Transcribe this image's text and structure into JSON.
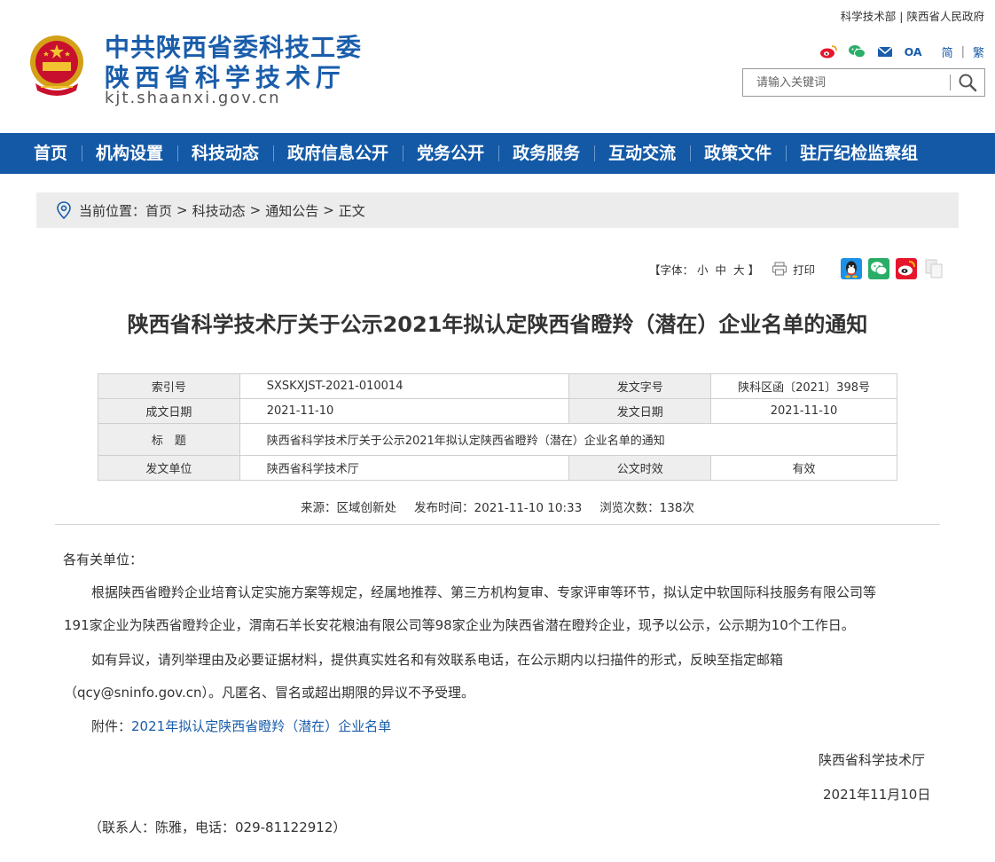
{
  "header": {
    "org_name_1": "中共陕西省委科技工委",
    "org_name_2": "陕西省科学技术厅",
    "domain": "kjt.shaanxi.gov.cn",
    "top_links": [
      "科学技术部",
      "陕西省人民政府"
    ],
    "oa_label": "OA",
    "lang_simplified": "简",
    "lang_traditional": "繁",
    "search_placeholder": "请输入关键词"
  },
  "nav": {
    "items": [
      "首页",
      "机构设置",
      "科技动态",
      "政府信息公开",
      "党务公开",
      "政务服务",
      "互动交流",
      "政策文件",
      "驻厅纪检监察组"
    ]
  },
  "breadcrumb": {
    "prefix": "当前位置：",
    "items": [
      "首页",
      "科技动态",
      "通知公告",
      "正文"
    ],
    "separator": ">"
  },
  "tools": {
    "font_prefix": "【字体：",
    "font_small": "小",
    "font_medium": "中",
    "font_large": "大",
    "font_suffix": "】",
    "print_label": "打印"
  },
  "article": {
    "title": "陕西省科学技术厅关于公示2021年拟认定陕西省瞪羚（潜在）企业名单的通知",
    "meta": {
      "index_label": "索引号",
      "index_value": "SXSKXJST-2021-010014",
      "doc_no_label": "发文字号",
      "doc_no_value": "陕科区函〔2021〕398号",
      "created_label": "成文日期",
      "created_value": "2021-11-10",
      "issued_label": "发文日期",
      "issued_value": "2021-11-10",
      "title_label": "标　题",
      "title_value": "陕西省科学技术厅关于公示2021年拟认定陕西省瞪羚（潜在）企业名单的通知",
      "unit_label": "发文单位",
      "unit_value": "陕西省科学技术厅",
      "validity_label": "公文时效",
      "validity_value": "有效"
    },
    "source": "来源：区域创新处",
    "publish_time": "发布时间：2021-11-10 10:33",
    "views": "浏览次数：138次",
    "salutation": "各有关单位：",
    "para1_line1": "根据陕西省瞪羚企业培育认定实施方案等规定，经属地推荐、第三方机构复审、专家评审等环节，拟认定中软国际科技服务有限公司等",
    "para1_line2": "191家企业为陕西省瞪羚企业，渭南石羊长安花粮油有限公司等98家企业为陕西省潜在瞪羚企业，现予以公示，公示期为10个工作日。",
    "para2_line1": "如有异议，请列举理由及必要证据材料，提供真实姓名和有效联系电话，在公示期内以扫描件的形式，反映至指定邮箱",
    "para2_line2": "（qcy@sninfo.gov.cn）。凡匿名、冒名或超出期限的异议不予受理。",
    "attachment_prefix": "附件：",
    "attachment_link": "2021年拟认定陕西省瞪羚（潜在）企业名单",
    "signature": "陕西省科学技术厅",
    "date": "2021年11月10日",
    "contact": "（联系人：陈雅，电话：029-81122912）"
  },
  "colors": {
    "brand_blue": "#1359a6",
    "title_blue": "#1a5dab",
    "link_blue": "#1a5dab"
  },
  "icons": [
    "national-emblem",
    "weibo-icon",
    "wechat-icon",
    "mail-icon",
    "search-icon",
    "location-pin-icon",
    "printer-icon",
    "qq-share-icon",
    "wechat-share-icon",
    "weibo-share-icon",
    "copy-icon"
  ]
}
